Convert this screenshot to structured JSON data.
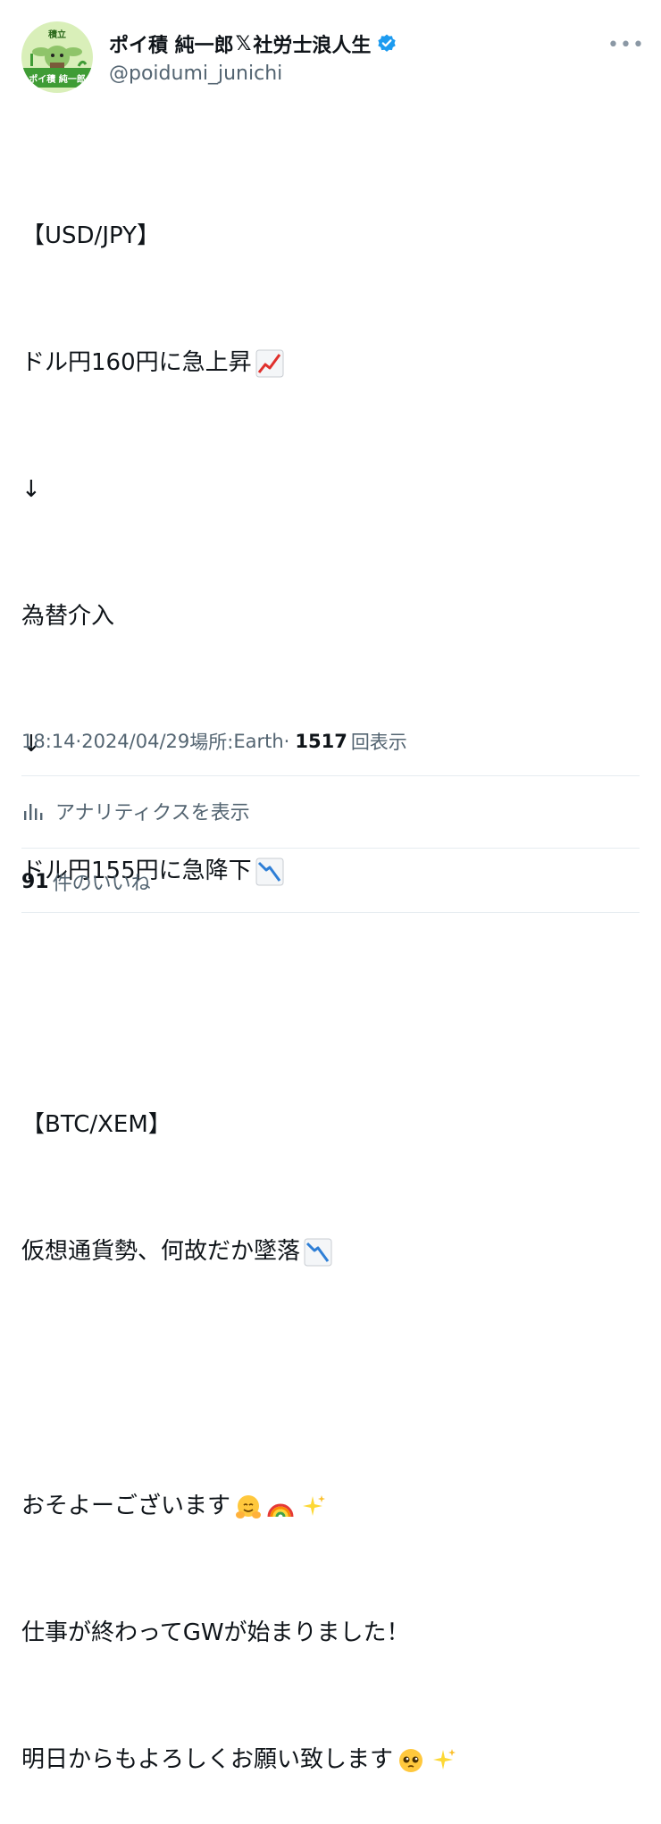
{
  "author": {
    "display_name": "ポイ積 純一郎",
    "x_glyph": "𝕏",
    "display_suffix": " 社労士浪人生",
    "handle": "@poidumi_junichi",
    "avatar_top_text": "積立",
    "avatar_bottom_text": "ポイ積 純一郎",
    "verified_color": "#1d9bf0"
  },
  "menu": {
    "more": "•••"
  },
  "tweet_lines": {
    "l1": "【USD/JPY】",
    "l2": "ドル円160円に急上昇",
    "l3": "↓",
    "l4": "為替介入",
    "l5": "↓",
    "l6": "ドル円155円に急降下",
    "l8": "【BTC/XEM】",
    "l9": "仮想通貨勢、何故だか墜落",
    "l11": "おそよーございます",
    "l12": "仕事が終わってGWが始まりました！",
    "l13": "明日からもよろしくお願い致します"
  },
  "meta": {
    "time": "18:14",
    "sep1": " · ",
    "date": "2024/04/29",
    "location_label": " 場所: ",
    "location": "Earth",
    "sep2": " · ",
    "views": "1517",
    "views_label": "回表示"
  },
  "analytics": {
    "label": "アナリティクスを表示"
  },
  "likes": {
    "count": "91",
    "label": "件のいいね"
  }
}
